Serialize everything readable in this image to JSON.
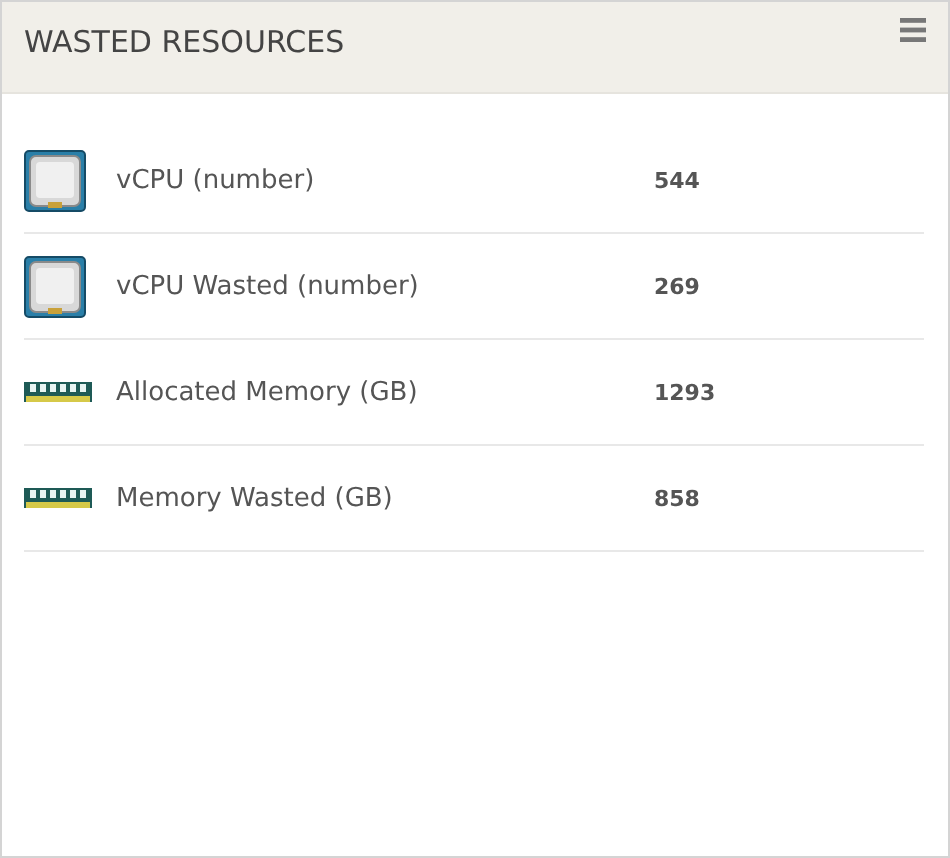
{
  "panel": {
    "title": "WASTED RESOURCES"
  },
  "rows": [
    {
      "kind": "cpu",
      "label": "vCPU (number)",
      "value": "544"
    },
    {
      "kind": "cpu",
      "label": "vCPU Wasted (number)",
      "value": "269"
    },
    {
      "kind": "memory",
      "label": "Allocated Memory (GB)",
      "value": "1293"
    },
    {
      "kind": "memory",
      "label": "Memory Wasted (GB)",
      "value": "858"
    }
  ]
}
